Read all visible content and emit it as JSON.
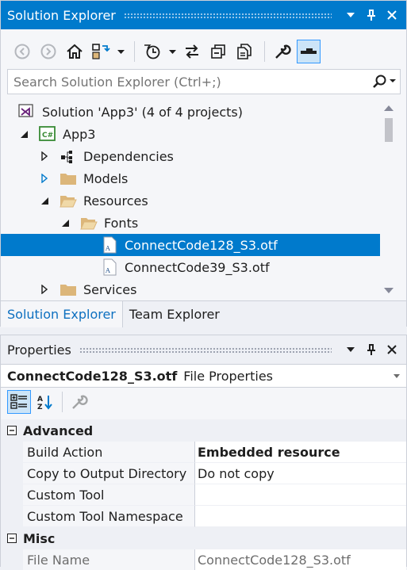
{
  "colors": {
    "accent": "#007acc",
    "selection_text": "#ffffff",
    "tab_active_text": "#0e70c0",
    "folder": "#dcb67a",
    "vs_purple": "#68217a",
    "csharp_green": "#388a34"
  },
  "solution_explorer": {
    "title": "Solution Explorer",
    "search_placeholder": "Search Solution Explorer (Ctrl+;)",
    "toolbar_icons": [
      "back-icon",
      "forward-icon",
      "home-icon",
      "switch-views-icon",
      "dropdown-icon",
      "pending-changes-icon",
      "dropdown-icon",
      "sync-icon",
      "collapse-all-icon",
      "show-all-files-icon",
      "properties-icon",
      "preview-icon"
    ],
    "tree": [
      {
        "label": "Solution 'App3' (4 of 4 projects)",
        "icon": "solution-icon",
        "expander": "none",
        "level": 0
      },
      {
        "label": "App3",
        "icon": "csharp-project-icon",
        "expander": "expanded",
        "level": 1
      },
      {
        "label": "Dependencies",
        "icon": "dependencies-icon",
        "expander": "collapsed",
        "level": 2
      },
      {
        "label": "Models",
        "icon": "folder-icon",
        "expander": "collapsed-hover",
        "level": 2
      },
      {
        "label": "Resources",
        "icon": "folder-open-icon",
        "expander": "expanded",
        "level": 2
      },
      {
        "label": "Fonts",
        "icon": "folder-open-icon",
        "expander": "expanded",
        "level": 3
      },
      {
        "label": "ConnectCode128_S3.otf",
        "icon": "font-file-icon",
        "expander": "none",
        "level": 4,
        "selected": true
      },
      {
        "label": "ConnectCode39_S3.otf",
        "icon": "font-file-icon",
        "expander": "none",
        "level": 4
      },
      {
        "label": "Services",
        "icon": "folder-icon",
        "expander": "collapsed",
        "level": 2
      }
    ],
    "tabs": [
      {
        "label": "Solution Explorer",
        "active": true
      },
      {
        "label": "Team Explorer",
        "active": false
      }
    ]
  },
  "properties": {
    "title": "Properties",
    "object_name": "ConnectCode128_S3.otf",
    "object_type": "File Properties",
    "toolbar_icons": [
      "categorized-icon",
      "alphabetical-icon",
      "property-pages-icon"
    ],
    "categories": [
      {
        "name": "Advanced",
        "rows": [
          {
            "name": "Build Action",
            "value": "Embedded resource",
            "bold": true
          },
          {
            "name": "Copy to Output Directory",
            "value": "Do not copy"
          },
          {
            "name": "Custom Tool",
            "value": ""
          },
          {
            "name": "Custom Tool Namespace",
            "value": ""
          }
        ]
      },
      {
        "name": "Misc",
        "rows": [
          {
            "name": "File Name",
            "value": "ConnectCode128_S3.otf",
            "dim": true
          }
        ]
      }
    ]
  }
}
